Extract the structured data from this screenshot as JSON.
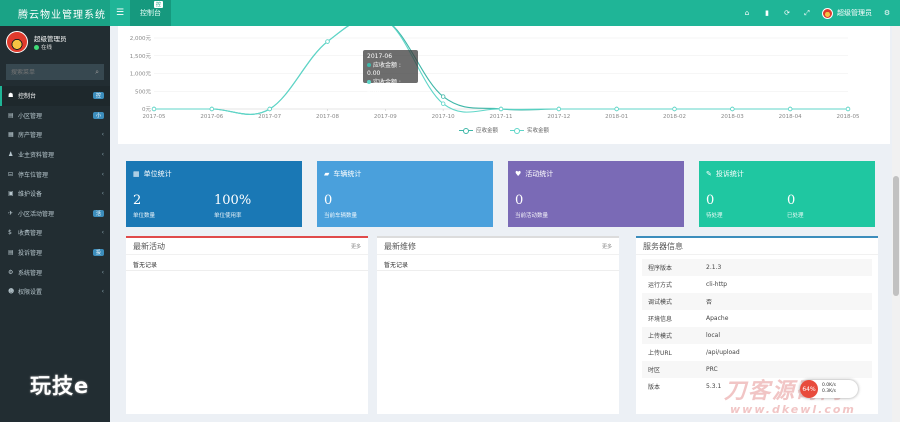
{
  "brand": "腾云物业管理系统",
  "header": {
    "tab_label": "控制台",
    "tab_badge": "控",
    "username": "超级管理员"
  },
  "sidebar": {
    "username": "超级管理员",
    "status": "在线",
    "search_placeholder": "搜索菜单",
    "items": [
      {
        "icon": "☗",
        "label": "控制台",
        "badge": "控",
        "chevron": ""
      },
      {
        "icon": "▤",
        "label": "小区管理",
        "badge": "小",
        "chevron": ""
      },
      {
        "icon": "▦",
        "label": "房产管理",
        "badge": "",
        "chevron": "‹"
      },
      {
        "icon": "♟",
        "label": "业主资料管理",
        "badge": "",
        "chevron": "‹"
      },
      {
        "icon": "⊟",
        "label": "停车位管理",
        "badge": "",
        "chevron": "‹"
      },
      {
        "icon": "▣",
        "label": "维护设备",
        "badge": "",
        "chevron": "‹"
      },
      {
        "icon": "✈",
        "label": "小区活动管理",
        "badge": "活",
        "chevron": ""
      },
      {
        "icon": "$",
        "label": "收费管理",
        "badge": "",
        "chevron": "‹"
      },
      {
        "icon": "▤",
        "label": "投诉管理",
        "badge": "投",
        "chevron": ""
      },
      {
        "icon": "⚙",
        "label": "系统管理",
        "badge": "",
        "chevron": "‹"
      },
      {
        "icon": "☻",
        "label": "权限设置",
        "badge": "",
        "chevron": "‹"
      }
    ]
  },
  "chart_data": {
    "type": "line",
    "categories": [
      "2017-05",
      "2017-06",
      "2017-07",
      "2017-08",
      "2017-09",
      "2017-10",
      "2017-11",
      "2017-12",
      "2018-01",
      "2018-02",
      "2018-03",
      "2018-04",
      "2018-05"
    ],
    "series": [
      {
        "name": "应收金额",
        "values": [
          0,
          0,
          0,
          1900,
          2500,
          350,
          0,
          0,
          0,
          0,
          0,
          0,
          0
        ]
      },
      {
        "name": "实收金额",
        "values": [
          0,
          0,
          0,
          1900,
          2500,
          150,
          0,
          0,
          0,
          0,
          0,
          0,
          0
        ]
      }
    ],
    "yticks": [
      "0元",
      "500元",
      "1,000元",
      "1,500元",
      "2,000元"
    ],
    "ylim": [
      0,
      2000
    ],
    "colors": [
      "#3fb7a8",
      "#5fd6c8"
    ],
    "tooltip": {
      "title": "2017-06",
      "lines": [
        "应收金额 : 0.00",
        "实收金额 : 0.00"
      ]
    },
    "legend_position": "bottom"
  },
  "stats": [
    {
      "title": "单位统计",
      "icon": "▦",
      "color": "#1a78b5",
      "vals": [
        {
          "num": "2",
          "label": "单位数量"
        },
        {
          "num": "100%",
          "label": "单位使用率"
        }
      ]
    },
    {
      "title": "车辆统计",
      "icon": "▰",
      "color": "#4aa0dc",
      "vals": [
        {
          "num": "0",
          "label": "当前车辆数量"
        }
      ]
    },
    {
      "title": "活动统计",
      "icon": "♥",
      "color": "#7a6ab6",
      "vals": [
        {
          "num": "0",
          "label": "当前活动数量"
        }
      ]
    },
    {
      "title": "投诉统计",
      "icon": "✎",
      "color": "#1fc7a1",
      "vals": [
        {
          "num": "0",
          "label": "待处理"
        },
        {
          "num": "0",
          "label": "已处理"
        }
      ]
    }
  ],
  "panels": {
    "activity": {
      "title": "最新活动",
      "more": "更多",
      "empty": "暂无记录"
    },
    "repair": {
      "title": "最新维修",
      "more": "更多",
      "empty": "暂无记录"
    },
    "server": {
      "title": "服务器信息",
      "rows": [
        {
          "k": "程序版本",
          "v": "2.1.3"
        },
        {
          "k": "运行方式",
          "v": "cli-http"
        },
        {
          "k": "调试模式",
          "v": "否"
        },
        {
          "k": "环境信息",
          "v": "Apache"
        },
        {
          "k": "上传模式",
          "v": "local"
        },
        {
          "k": "上传URL",
          "v": "/api/upload"
        },
        {
          "k": "时区",
          "v": "PRC"
        },
        {
          "k": "版本",
          "v": "5.3.1"
        }
      ]
    }
  },
  "watermarks": {
    "left": "玩技e",
    "right": "刀客源码网",
    "url": "www.dkewl.com"
  },
  "speed": {
    "pct": "64%",
    "up": "0.0K/s",
    "down": "0.3K/s"
  }
}
